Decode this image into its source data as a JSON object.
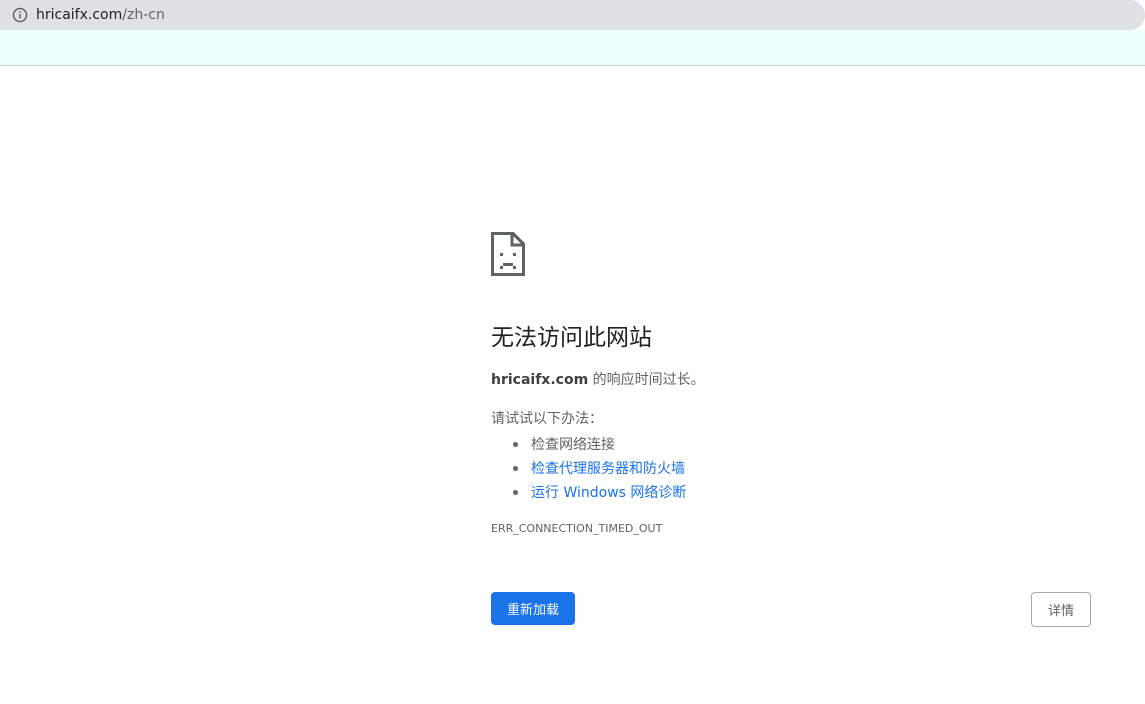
{
  "address_bar": {
    "host": "hricaifx.com",
    "path": "/zh-cn",
    "icon": "info-icon"
  },
  "error_page": {
    "icon": "sad-page-icon",
    "title": "无法访问此网站",
    "host_bold": "hricaifx.com",
    "subtitle_rest": " 的响应时间过长。",
    "try_label": "请试试以下办法：",
    "suggestions": [
      {
        "label": "检查网络连接",
        "link": false
      },
      {
        "label": "检查代理服务器和防火墙",
        "link": true
      },
      {
        "label": "运行 Windows 网络诊断",
        "link": true
      }
    ],
    "error_code": "ERR_CONNECTION_TIMED_OUT",
    "reload_label": "重新加载",
    "details_label": "详情"
  },
  "colors": {
    "accent": "#1a73e8",
    "text_primary": "#202124",
    "text_secondary": "#5f6368",
    "address_bar_bg": "#dee1e6",
    "infobar_bg": "#f0ffff"
  }
}
